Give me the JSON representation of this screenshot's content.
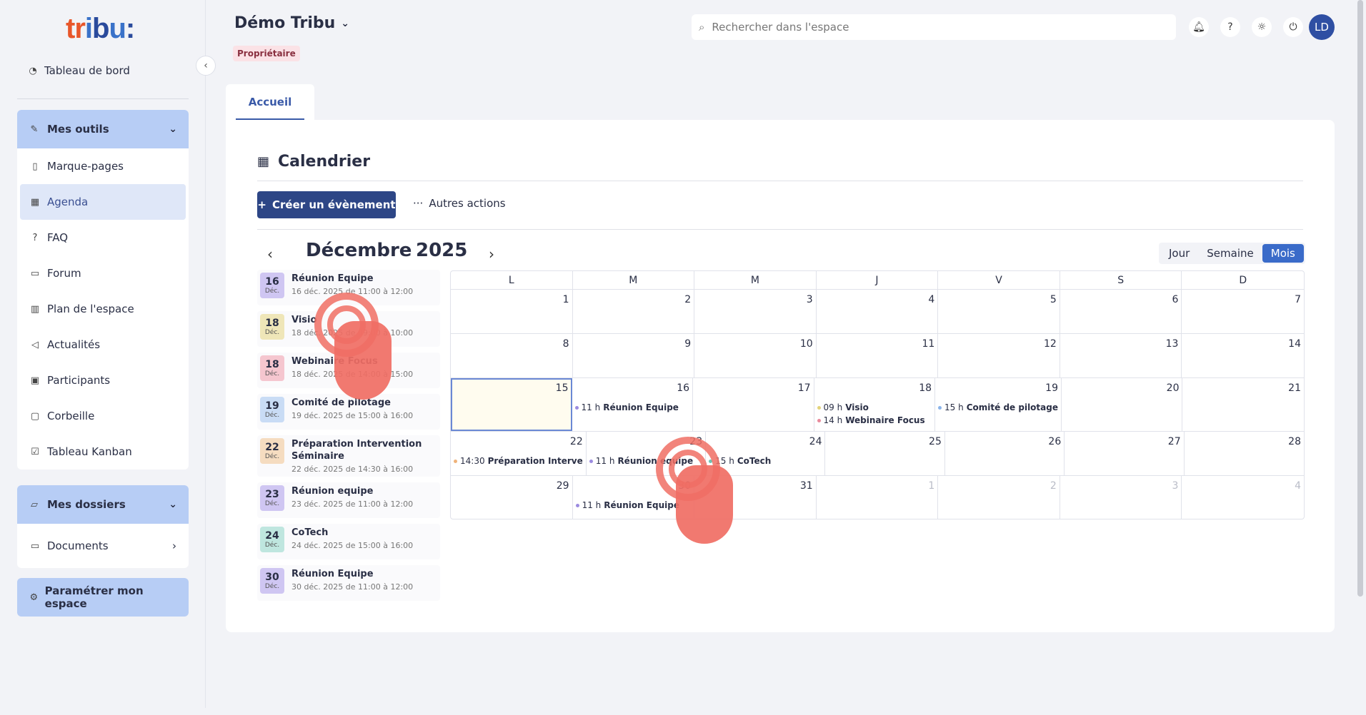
{
  "logo": {
    "text": "tribu:"
  },
  "sidebar": {
    "dashboard": "Tableau de bord",
    "tools_header": "Mes outils",
    "tools": [
      {
        "label": "Marque-pages",
        "icon": "bookmark-icon"
      },
      {
        "label": "Agenda",
        "icon": "calendar-icon"
      },
      {
        "label": "FAQ",
        "icon": "help-icon"
      },
      {
        "label": "Forum",
        "icon": "chat-icon"
      },
      {
        "label": "Plan de l'espace",
        "icon": "map-icon"
      },
      {
        "label": "Actualités",
        "icon": "megaphone-icon"
      },
      {
        "label": "Participants",
        "icon": "contacts-icon"
      },
      {
        "label": "Corbeille",
        "icon": "trash-icon"
      },
      {
        "label": "Tableau Kanban",
        "icon": "checkbox-icon"
      }
    ],
    "folders_header": "Mes dossiers",
    "folders": [
      {
        "label": "Documents",
        "icon": "folder-icon"
      }
    ],
    "settings": "Paramétrer mon espace"
  },
  "header": {
    "space_title": "Démo Tribu",
    "role_badge": "Propriétaire",
    "search_placeholder": "Rechercher dans l'espace",
    "avatar_initials": "LD"
  },
  "tabs": [
    {
      "label": "Accueil",
      "active": true
    }
  ],
  "calendar": {
    "title": "Calendrier",
    "create_button": "Créer un évènement",
    "other_actions": "Autres actions",
    "month": "Décembre",
    "year": "2025",
    "views": [
      "Jour",
      "Semaine",
      "Mois"
    ],
    "active_view": "Mois",
    "weekdays": [
      "L",
      "M",
      "M",
      "J",
      "V",
      "S",
      "D"
    ],
    "events_list": [
      {
        "day": "16",
        "month": "Déc.",
        "title": "Réunion Equipe",
        "when": "16 déc. 2025 de 11:00 à 12:00",
        "color": "#cfc6f2"
      },
      {
        "day": "18",
        "month": "Déc.",
        "title": "Visio",
        "when": "18 déc. 2025 de 09:00 à 10:00",
        "color": "#efe6b8"
      },
      {
        "day": "18",
        "month": "Déc.",
        "title": "Webinaire Focus",
        "when": "18 déc. 2025 de 14:00 à 15:00",
        "color": "#f5c6cf"
      },
      {
        "day": "19",
        "month": "Déc.",
        "title": "Comité de pilotage",
        "when": "19 déc. 2025 de 15:00 à 16:00",
        "color": "#c9dcf5"
      },
      {
        "day": "22",
        "month": "Déc.",
        "title": "Préparation Intervention Séminaire",
        "when": "22 déc. 2025 de 14:30 à 16:00",
        "color": "#f5dcc0"
      },
      {
        "day": "23",
        "month": "Déc.",
        "title": "Réunion equipe",
        "when": "23 déc. 2025 de 11:00 à 12:00",
        "color": "#cfc6f2"
      },
      {
        "day": "24",
        "month": "Déc.",
        "title": "CoTech",
        "when": "24 déc. 2025 de 15:00 à 16:00",
        "color": "#bfe6df"
      },
      {
        "day": "30",
        "month": "Déc.",
        "title": "Réunion Equipe",
        "when": "30 déc. 2025 de 11:00 à 12:00",
        "color": "#cfc6f2"
      }
    ],
    "weeks": [
      [
        {
          "n": "1"
        },
        {
          "n": "2"
        },
        {
          "n": "3"
        },
        {
          "n": "4"
        },
        {
          "n": "5"
        },
        {
          "n": "6"
        },
        {
          "n": "7"
        }
      ],
      [
        {
          "n": "8"
        },
        {
          "n": "9"
        },
        {
          "n": "10"
        },
        {
          "n": "11"
        },
        {
          "n": "12"
        },
        {
          "n": "13"
        },
        {
          "n": "14"
        }
      ],
      [
        {
          "n": "15",
          "today": true
        },
        {
          "n": "16",
          "events": [
            {
              "time": "11 h",
              "title": "Réunion Equipe",
              "color": "#9b8be0"
            }
          ]
        },
        {
          "n": "17"
        },
        {
          "n": "18",
          "events": [
            {
              "time": "09 h",
              "title": "Visio",
              "color": "#e3d37a"
            },
            {
              "time": "14 h",
              "title": "Webinaire Focus",
              "color": "#e98a9c"
            }
          ]
        },
        {
          "n": "19",
          "events": [
            {
              "time": "15 h",
              "title": "Comité de pilotage",
              "color": "#8ab4ea"
            }
          ]
        },
        {
          "n": "20"
        },
        {
          "n": "21"
        }
      ],
      [
        {
          "n": "22",
          "events": [
            {
              "time": "14:30",
              "title": "Préparation Interve",
              "color": "#efb27a"
            }
          ]
        },
        {
          "n": "23",
          "events": [
            {
              "time": "11 h",
              "title": "Réunion equipe",
              "color": "#9b8be0"
            }
          ]
        },
        {
          "n": "24",
          "events": [
            {
              "time": "15 h",
              "title": "CoTech",
              "color": "#6cc5b5"
            }
          ]
        },
        {
          "n": "25"
        },
        {
          "n": "26"
        },
        {
          "n": "27"
        },
        {
          "n": "28"
        }
      ],
      [
        {
          "n": "29"
        },
        {
          "n": "30",
          "events": [
            {
              "time": "11 h",
              "title": "Réunion Equipe",
              "color": "#9b8be0"
            }
          ]
        },
        {
          "n": "31"
        },
        {
          "n": "1",
          "other": true
        },
        {
          "n": "2",
          "other": true
        },
        {
          "n": "3",
          "other": true
        },
        {
          "n": "4",
          "other": true
        }
      ]
    ]
  }
}
